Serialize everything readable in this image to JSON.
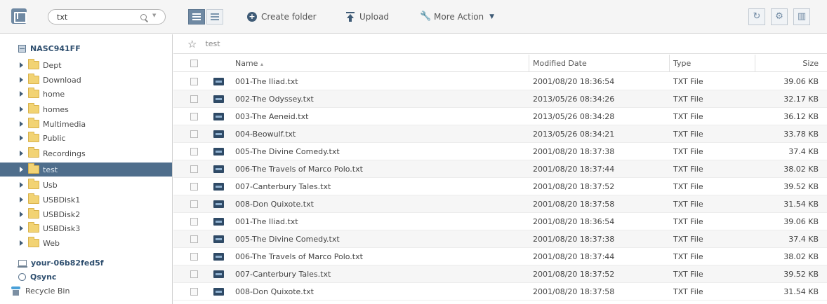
{
  "search": {
    "value": "txt"
  },
  "toolbar": {
    "create_folder": "Create folder",
    "upload": "Upload",
    "more_action": "More Action"
  },
  "sidebar": {
    "root": "NASC941FF",
    "folders": [
      "Dept",
      "Download",
      "home",
      "homes",
      "Multimedia",
      "Public",
      "Recordings",
      "test",
      "Usb",
      "USBDisk1",
      "USBDisk2",
      "USBDisk3",
      "Web"
    ],
    "selected": "test",
    "pc": "your-06b82fed5f",
    "qsync": "Qsync",
    "recycle": "Recycle Bin"
  },
  "breadcrumb": "test",
  "table": {
    "headers": {
      "name": "Name",
      "sort_indicator": "▴",
      "modified": "Modified Date",
      "type": "Type",
      "size": "Size"
    },
    "rows": [
      {
        "name": "001-The Iliad.txt",
        "modified": "2001/08/20 18:36:54",
        "type": "TXT File",
        "size": "39.06 KB"
      },
      {
        "name": "002-The Odyssey.txt",
        "modified": "2013/05/26 08:34:26",
        "type": "TXT File",
        "size": "32.17 KB"
      },
      {
        "name": "003-The Aeneid.txt",
        "modified": "2013/05/26 08:34:28",
        "type": "TXT File",
        "size": "36.12 KB"
      },
      {
        "name": "004-Beowulf.txt",
        "modified": "2013/05/26 08:34:21",
        "type": "TXT File",
        "size": "33.78 KB"
      },
      {
        "name": "005-The Divine Comedy.txt",
        "modified": "2001/08/20 18:37:38",
        "type": "TXT File",
        "size": "37.4 KB"
      },
      {
        "name": "006-The Travels of Marco Polo.txt",
        "modified": "2001/08/20 18:37:44",
        "type": "TXT File",
        "size": "38.02 KB"
      },
      {
        "name": "007-Canterbury Tales.txt",
        "modified": "2001/08/20 18:37:52",
        "type": "TXT File",
        "size": "39.52 KB"
      },
      {
        "name": "008-Don Quixote.txt",
        "modified": "2001/08/20 18:37:58",
        "type": "TXT File",
        "size": "31.54 KB"
      },
      {
        "name": "001-The Iliad.txt",
        "modified": "2001/08/20 18:36:54",
        "type": "TXT File",
        "size": "39.06 KB"
      },
      {
        "name": "005-The Divine Comedy.txt",
        "modified": "2001/08/20 18:37:38",
        "type": "TXT File",
        "size": "37.4 KB"
      },
      {
        "name": "006-The Travels of Marco Polo.txt",
        "modified": "2001/08/20 18:37:44",
        "type": "TXT File",
        "size": "38.02 KB"
      },
      {
        "name": "007-Canterbury Tales.txt",
        "modified": "2001/08/20 18:37:52",
        "type": "TXT File",
        "size": "39.52 KB"
      },
      {
        "name": "008-Don Quixote.txt",
        "modified": "2001/08/20 18:37:58",
        "type": "TXT File",
        "size": "31.54 KB"
      }
    ]
  },
  "icons": {
    "app": "file-station-icon",
    "search": "search-icon",
    "detail_view": "detail-view-icon",
    "list_view": "list-view-icon",
    "create_folder": "plus-circle-icon",
    "upload": "upload-icon",
    "more_action": "wrench-icon",
    "refresh": "refresh-icon",
    "settings": "gear-icon",
    "panel": "panel-icon",
    "folder": "folder-icon",
    "file": "txt-file-icon",
    "favorite": "star-icon"
  },
  "colors": {
    "accent": "#6f89a3",
    "selected_row": "#4f6e8c",
    "folder": "#f2d374"
  }
}
